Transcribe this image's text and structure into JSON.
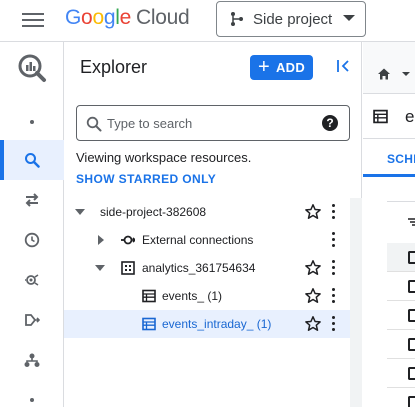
{
  "header": {
    "logo_google_letters": [
      "G",
      "o",
      "o",
      "g",
      "l",
      "e"
    ],
    "logo_cloud": "Cloud",
    "project_name": "Side project"
  },
  "explorer": {
    "title": "Explorer",
    "add_label": "ADD",
    "search_placeholder": "Type to search",
    "help_label": "?",
    "viewing_text": "Viewing workspace resources.",
    "show_starred_label": "SHOW STARRED ONLY",
    "tree": [
      {
        "label": "side-project-382608",
        "icon": "project-icon",
        "expanded": true
      },
      {
        "label": "External connections",
        "icon": "external-connection-icon",
        "expanded": false
      },
      {
        "label": "analytics_361754634",
        "icon": "dataset-icon",
        "expanded": true
      },
      {
        "label": "events_ (1)",
        "icon": "table-icon"
      },
      {
        "label": "events_intraday_ (1)",
        "icon": "table-icon",
        "selected": true
      }
    ]
  },
  "rail": {
    "items": [
      {
        "name": "bigquery-logo-icon"
      },
      {
        "name": "dot-icon"
      },
      {
        "name": "search-icon",
        "active": true
      },
      {
        "name": "data-transfer-icon"
      },
      {
        "name": "scheduled-queries-icon"
      },
      {
        "name": "analytics-hub-icon"
      },
      {
        "name": "dataform-icon"
      },
      {
        "name": "bi-engine-icon"
      },
      {
        "name": "dot-icon"
      }
    ]
  },
  "right_pane": {
    "table_title_partial": "e",
    "tab_partial": "SCHE"
  },
  "colors": {
    "accent": "#1a73e8",
    "selected_bg": "#e8f0fe",
    "text": "#202124",
    "muted": "#5f6368"
  }
}
